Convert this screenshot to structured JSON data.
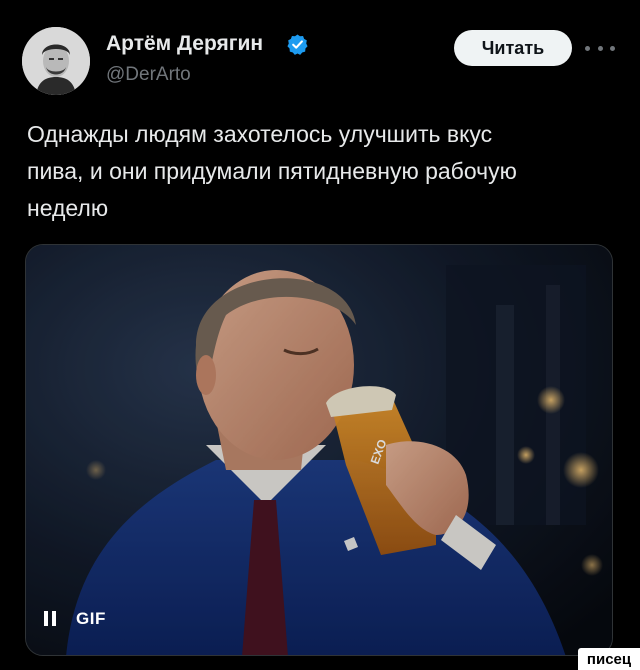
{
  "author": {
    "name": "Артём Дерягин",
    "handle": "@DerArto",
    "verified": true
  },
  "actions": {
    "follow_label": "Читать",
    "more_icon": "more-dots-icon"
  },
  "tweet": {
    "lines": [
      "Однажды людям захотелось улучшить вкус",
      "пива, и они придумали пятидневную рабочую",
      "неделю"
    ]
  },
  "media": {
    "type": "gif",
    "badge": "GIF",
    "pause_icon": "pause-icon",
    "glass_label": "EXO"
  },
  "watermark": "писец",
  "colors": {
    "background": "#000000",
    "text_primary": "#e7e9ea",
    "text_secondary": "#71767b",
    "verified_blue": "#1d9bf0",
    "button_bg": "#eff3f4"
  }
}
